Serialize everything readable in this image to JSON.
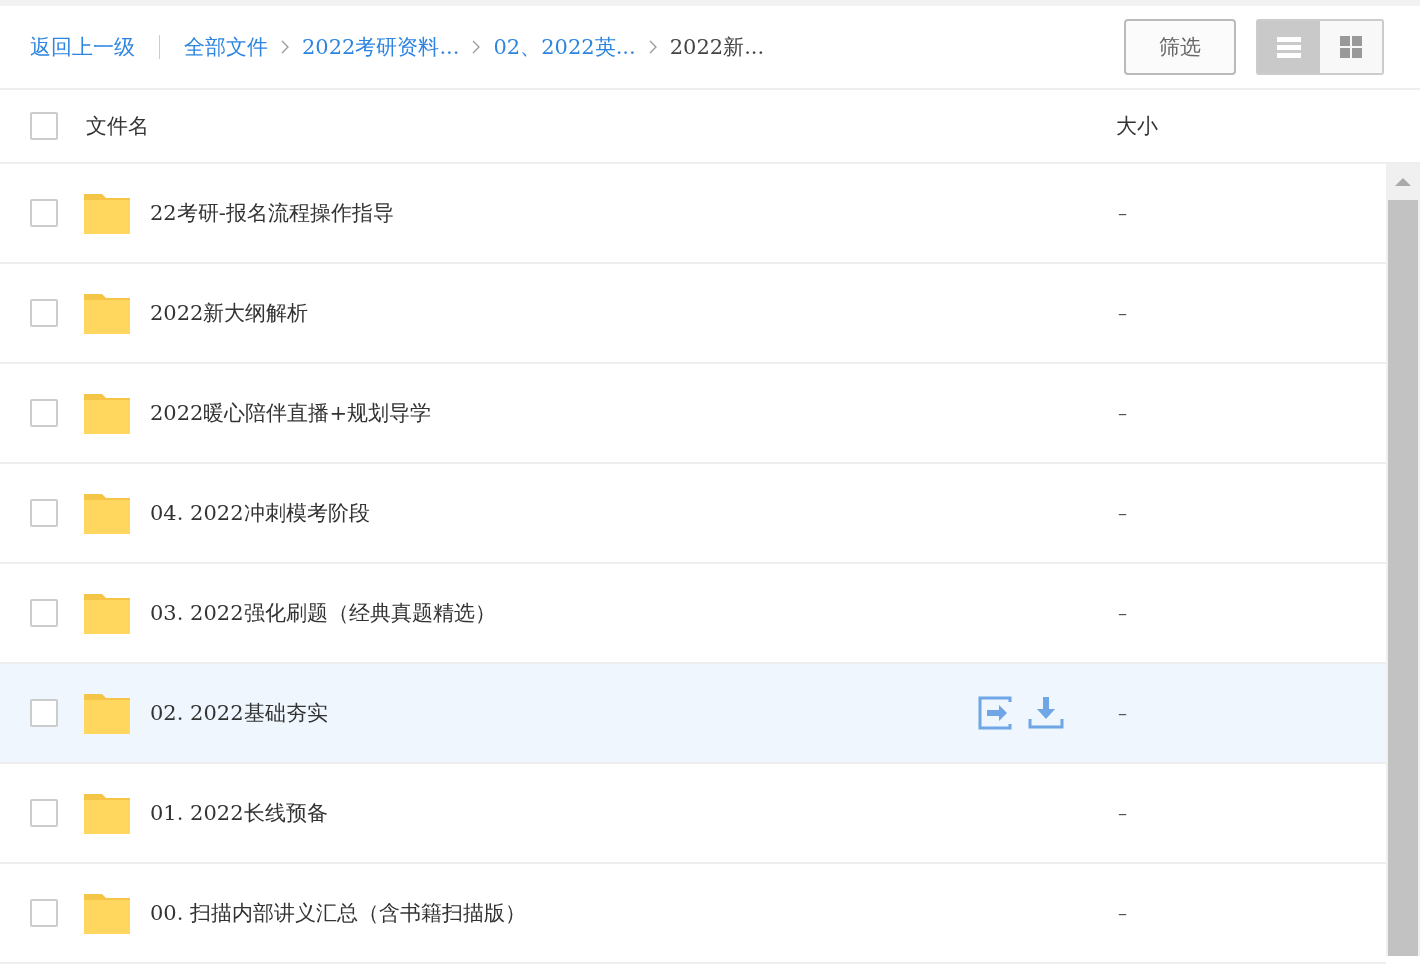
{
  "toolbar": {
    "back": "返回上一级",
    "breadcrumbs": [
      {
        "label": "全部文件",
        "current": false
      },
      {
        "label": "2022考研资料...",
        "current": false
      },
      {
        "label": "02、2022英...",
        "current": false
      },
      {
        "label": "2022新...",
        "current": true
      }
    ],
    "filter": "筛选",
    "views": [
      {
        "kind": "list",
        "selected": true
      },
      {
        "kind": "grid",
        "selected": false
      }
    ]
  },
  "table": {
    "columns": [
      "文件名",
      "大小"
    ],
    "all_checked": false,
    "rows": [
      {
        "name": "22考研-报名流程操作指导",
        "size": "–",
        "selected": false
      },
      {
        "name": "2022新大纲解析",
        "size": "–",
        "selected": false
      },
      {
        "name": "2022暖心陪伴直播+规划导学",
        "size": "–",
        "selected": false
      },
      {
        "name": "04. 2022冲刺模考阶段",
        "size": "–",
        "selected": false
      },
      {
        "name": "03. 2022强化刷题（经典真题精选）",
        "size": "–",
        "selected": false
      },
      {
        "name": "02. 2022基础夯实",
        "size": "–",
        "selected": true
      },
      {
        "name": "01. 2022长线预备",
        "size": "–",
        "selected": false
      },
      {
        "name": "00. 扫描内部讲义汇总（含书籍扫描版）",
        "size": "–",
        "selected": false
      }
    ]
  }
}
